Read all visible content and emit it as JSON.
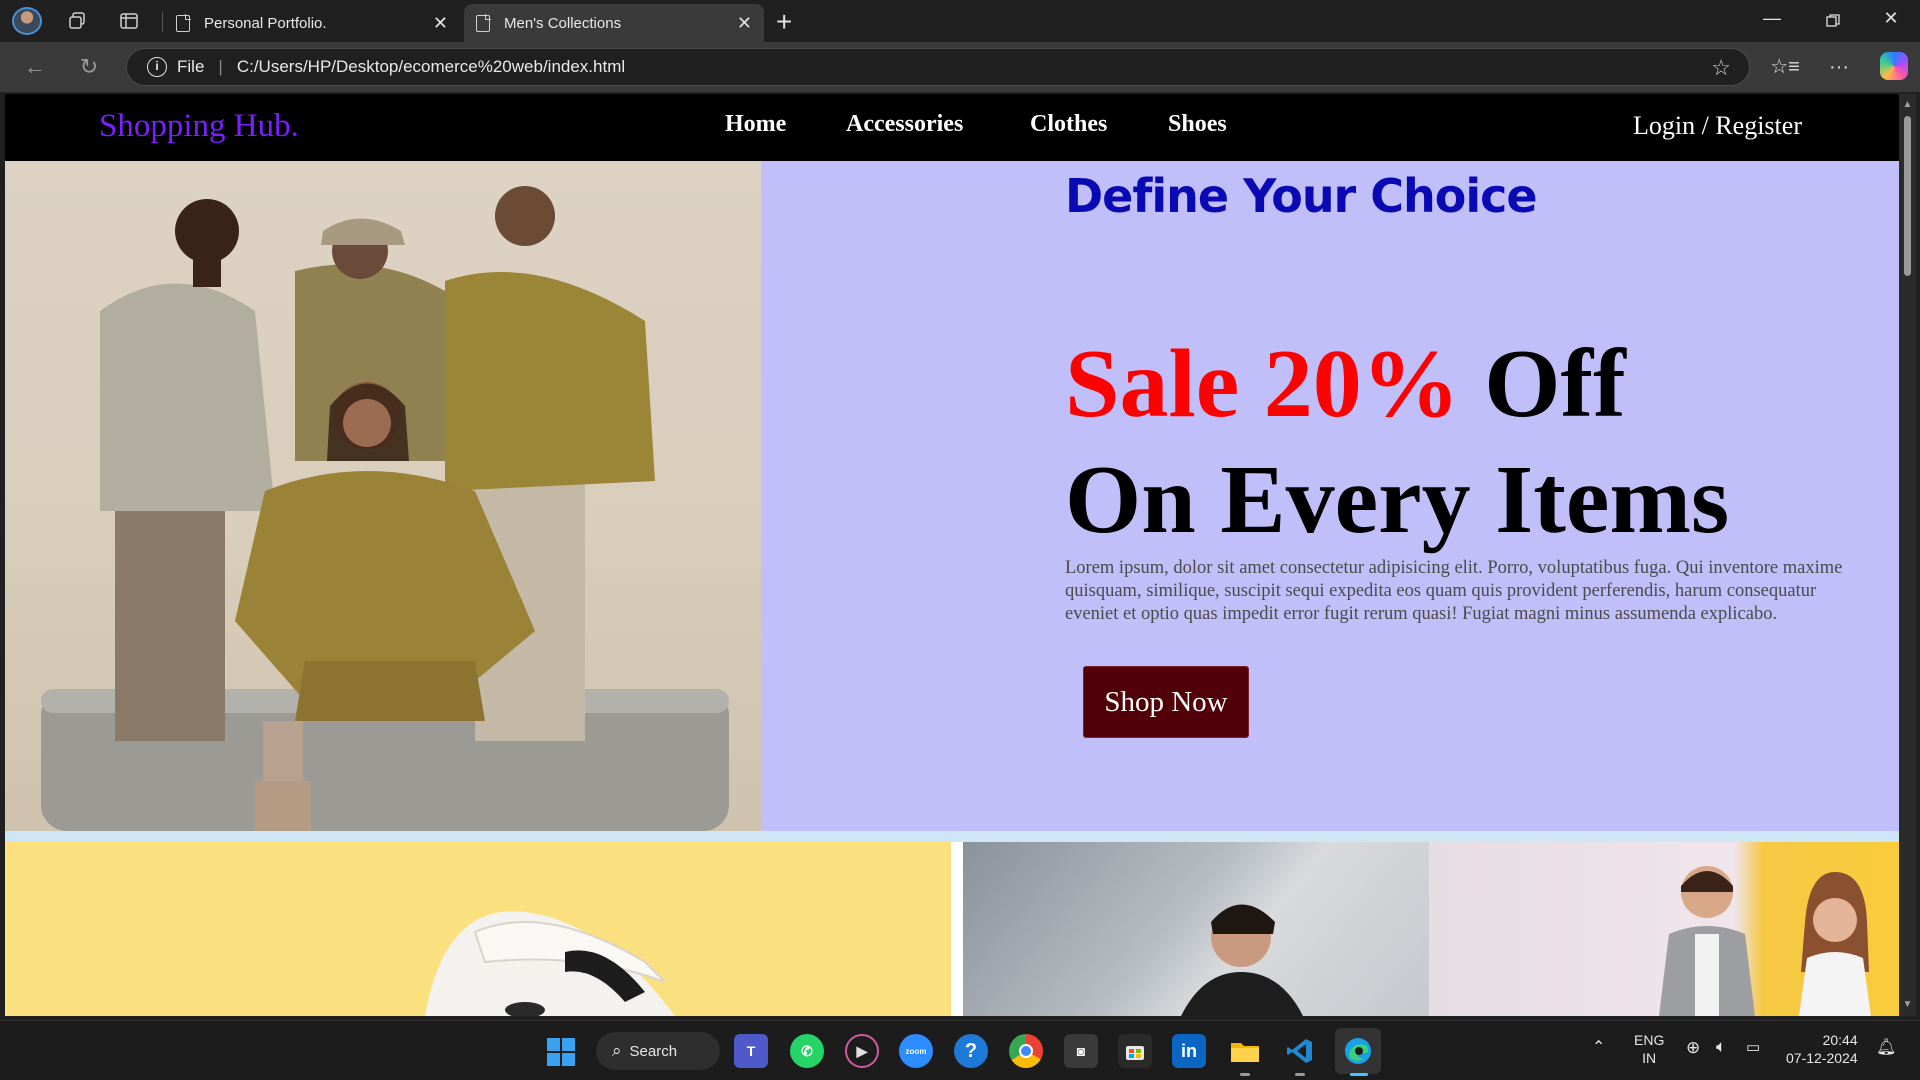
{
  "browser": {
    "tabs": [
      {
        "title": "Personal Portfolio.",
        "active": false
      },
      {
        "title": "Men's Collections",
        "active": true
      }
    ],
    "address": {
      "scheme_label": "File",
      "url": "C:/Users/HP/Desktop/ecomerce%20web/index.html"
    }
  },
  "site": {
    "brand": "Shopping Hub.",
    "nav": [
      "Home",
      "Accessories",
      "Clothes",
      "Shoes"
    ],
    "login": "Login / Register"
  },
  "hero": {
    "tagline": "Define Your Choice",
    "sale_red": "Sale 20%",
    "sale_rest": " Off",
    "items": "On Every Items",
    "description": "Lorem ipsum, dolor sit amet consectetur adipisicing elit. Porro, voluptatibus fuga. Qui inventore maxime quisquam, similique, suscipit sequi expedita eos quam quis provident perferendis, harum consequatur",
    "description_2": "eveniet et optio quas impedit error fugit rerum quasi! Fugiat magni minus assumenda explicabo.",
    "cta": "Shop Now"
  },
  "taskbar": {
    "search_label": "Search",
    "language": "ENG",
    "region": "IN",
    "time": "20:44",
    "date": "07-12-2024"
  },
  "colors": {
    "brand": "#7a1fff",
    "tagline": "#0a0ab4",
    "sale_red": "#ff0000",
    "hero_bg": "#c0bff9",
    "cta_bg": "#520008"
  }
}
